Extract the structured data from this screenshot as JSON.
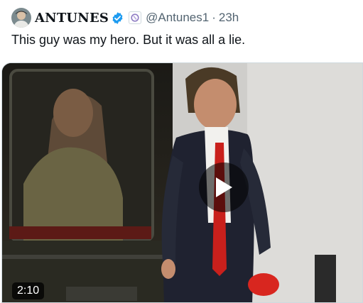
{
  "post": {
    "author": {
      "display_name": "ANTUNES",
      "handle": "@Antunes1",
      "verified": true,
      "avatar_icon": "user-avatar",
      "affiliate_icon": "affiliate-badge-icon"
    },
    "separator": "·",
    "timestamp": "23h",
    "text": "This guy was my hero. But it was all a lie."
  },
  "media": {
    "type": "video",
    "duration": "2:10",
    "play_icon": "play-icon"
  },
  "colors": {
    "verified_blue": "#1d9bf0",
    "secondary_text": "#536471",
    "primary_text": "#0f1419"
  }
}
